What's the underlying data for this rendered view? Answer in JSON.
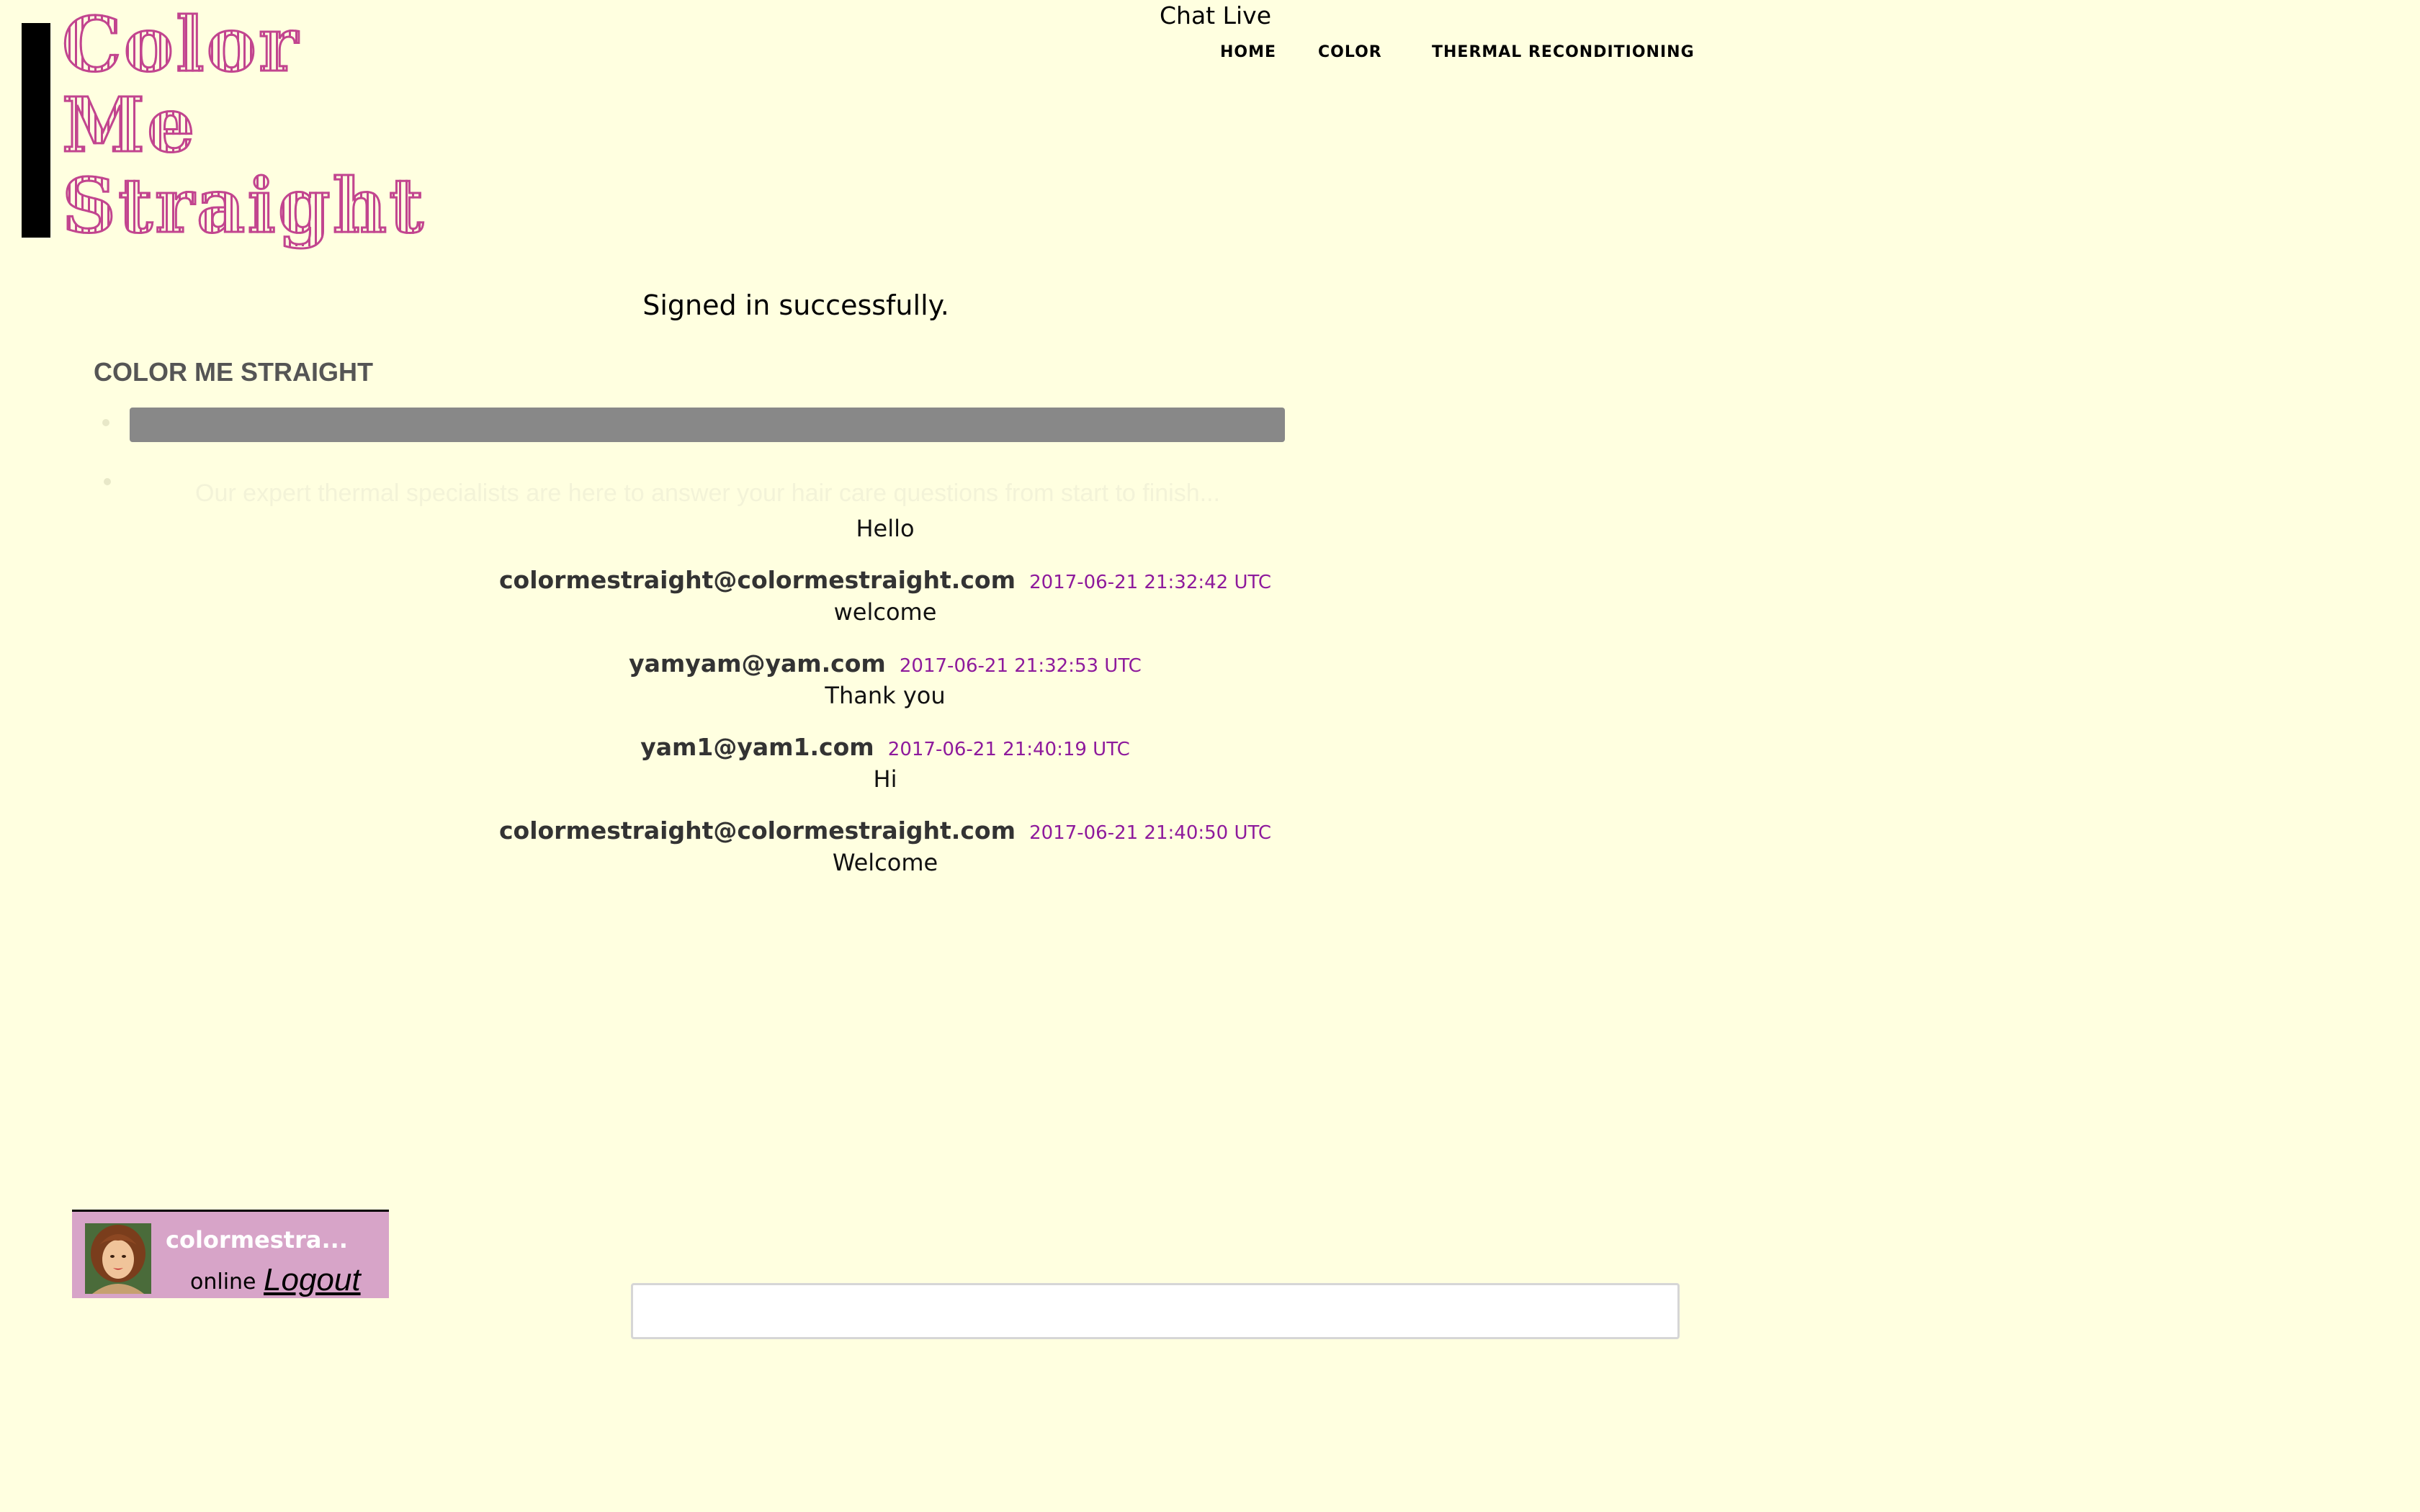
{
  "logo": {
    "line1": "Color",
    "line2": "Me",
    "line3": "Straight"
  },
  "header": {
    "chat_live": "Chat Live"
  },
  "nav": {
    "items": [
      {
        "label": "HOME"
      },
      {
        "label": "COLOR"
      },
      {
        "label": "THERMAL RECONDITIONING"
      }
    ]
  },
  "flash": {
    "message": "Signed in successfully."
  },
  "section": {
    "title": "COLOR ME STRAIGHT",
    "tagline": "Our expert thermal specialists are here to answer your hair care questions from start to finish..."
  },
  "chat": {
    "first_message": "Hello",
    "messages": [
      {
        "author": "colormestraight@colormestraight.com",
        "time": "2017-06-21 21:32:42 UTC",
        "body": "welcome"
      },
      {
        "author": "yamyam@yam.com",
        "time": "2017-06-21 21:32:53 UTC",
        "body": "Thank you"
      },
      {
        "author": "yam1@yam1.com",
        "time": "2017-06-21 21:40:19 UTC",
        "body": "Hi"
      },
      {
        "author": "colormestraight@colormestraight.com",
        "time": "2017-06-21 21:40:50 UTC",
        "body": "Welcome"
      }
    ],
    "input_value": ""
  },
  "user": {
    "name": "colormestra...",
    "status": "online",
    "logout_label": "Logout",
    "avatar_icon": "user-avatar-photo"
  },
  "colors": {
    "background": "#ffffe0",
    "logo_pink": "#c2458f",
    "badge_pink": "#d7a4c8",
    "timestamp_purple": "#8e1a9c",
    "bar_gray": "#888888"
  }
}
